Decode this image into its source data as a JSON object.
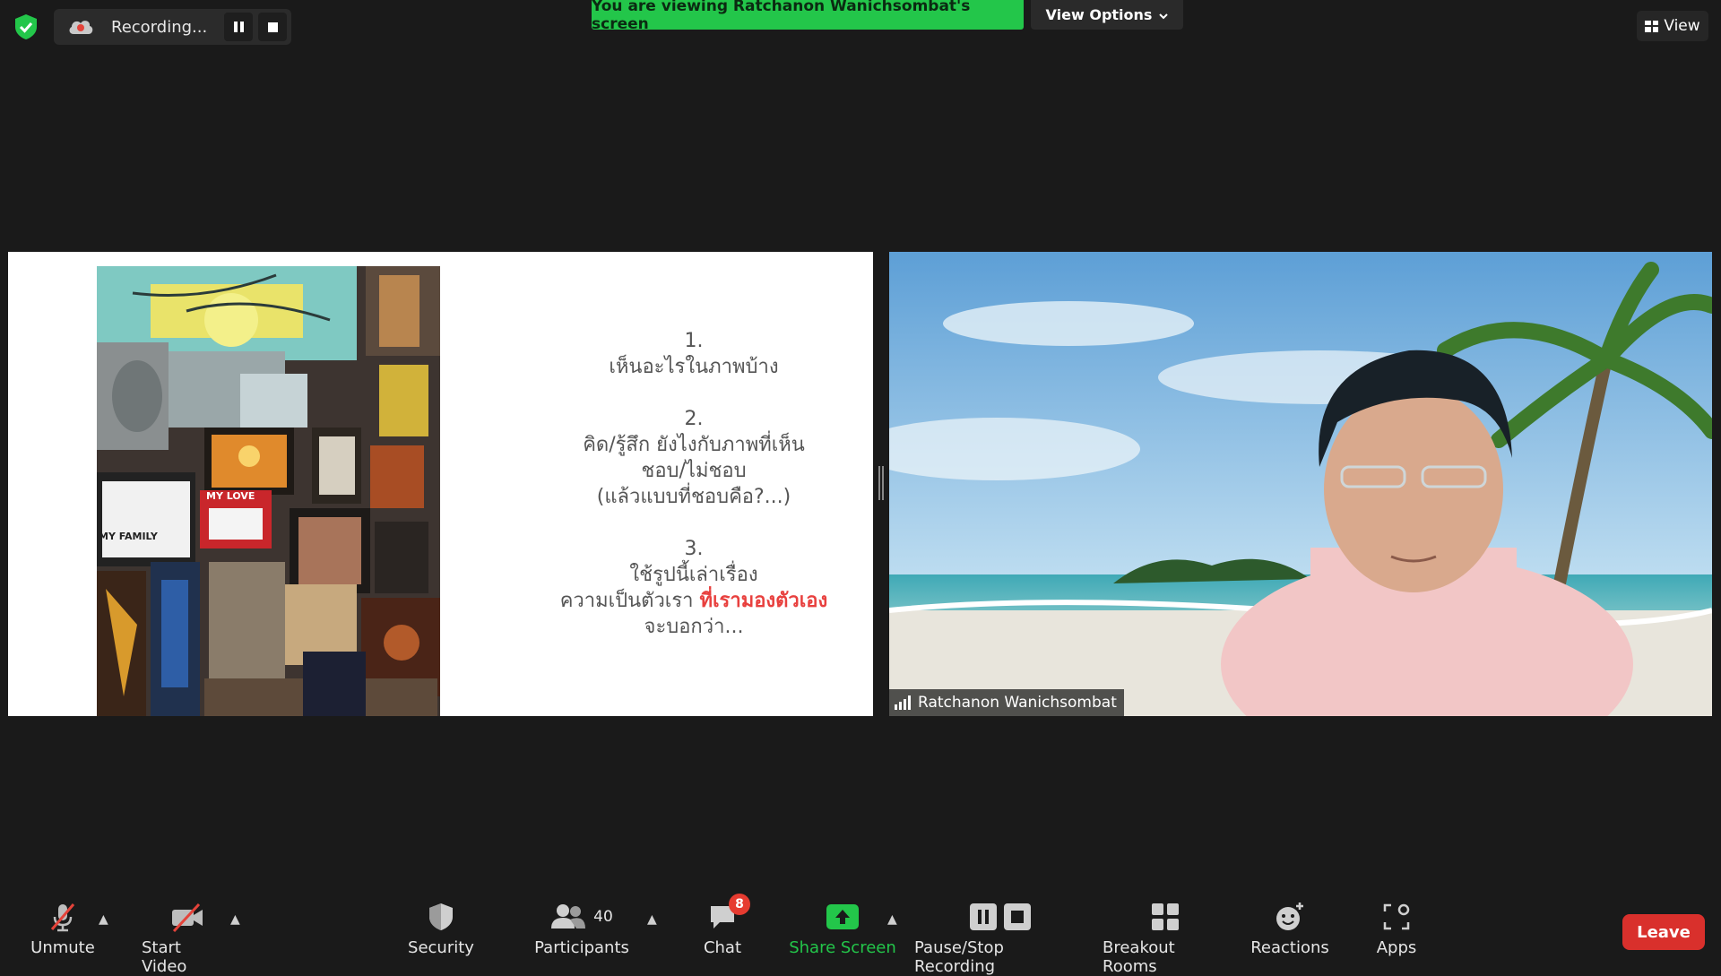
{
  "top": {
    "recording_label": "Recording...",
    "banner_text": "You are viewing Ratchanon Wanichsombat's screen",
    "view_options_label": "View Options",
    "view_label": "View"
  },
  "slide": {
    "item1_num": "1.",
    "item1_line1": "เห็นอะไรในภาพบ้าง",
    "item2_num": "2.",
    "item2_line1": "คิด/รู้สึก ยังไงกับภาพที่เห็น",
    "item2_line2": "ชอบ/ไม่ชอบ",
    "item2_line3": "(แล้วแบบที่ชอบคือ?...)",
    "item3_num": "3.",
    "item3_line1": "ใช้รูปนี้เล่าเรื่อง",
    "item3_line2_prefix": "ความเป็นตัวเรา ",
    "item3_line2_highlight": "ที่เรามองตัวเอง",
    "item3_line3": "จะบอกว่า...",
    "highlight_color": "#e8403e",
    "art_label_1": "MY LOVE",
    "art_label_2": "MY FAMILY"
  },
  "video": {
    "participant_name": "Ratchanon Wanichsombat"
  },
  "toolbar": {
    "unmute": "Unmute",
    "start_video": "Start Video",
    "security": "Security",
    "participants": "Participants",
    "participants_count": "40",
    "chat": "Chat",
    "chat_badge": "8",
    "share_screen": "Share Screen",
    "pause_stop": "Pause/Stop Recording",
    "breakout": "Breakout Rooms",
    "reactions": "Reactions",
    "apps": "Apps",
    "leave": "Leave"
  },
  "colors": {
    "banner": "#23c64a",
    "share_green": "#23c64a",
    "leave_red": "#d9302c",
    "background": "#1a1a1a"
  }
}
